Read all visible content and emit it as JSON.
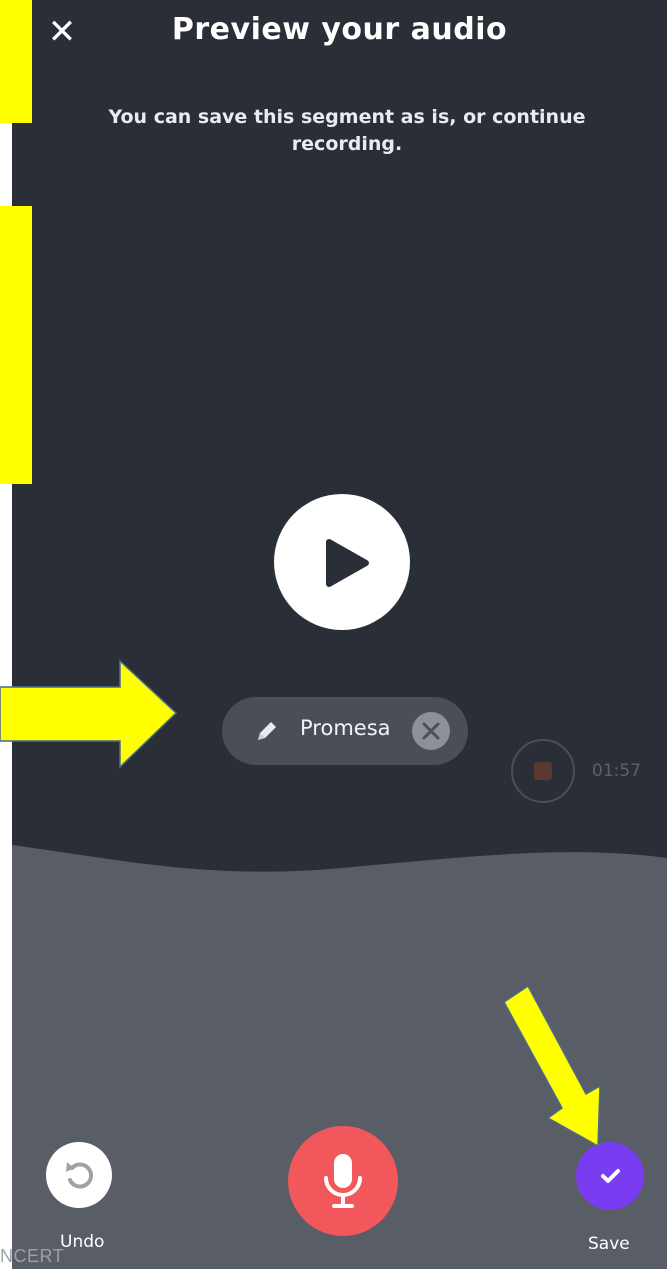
{
  "header": {
    "close_icon": "close-icon",
    "title": "Preview your audio",
    "subtitle": "You can save this segment as is, or continue recording."
  },
  "player": {
    "play_icon": "play-icon"
  },
  "segment_chip": {
    "edit_icon": "pencil-icon",
    "label": "Promesa",
    "clear_icon": "close-circle-icon"
  },
  "recorder": {
    "stop_icon": "stop-icon",
    "timer": "01:57"
  },
  "bottom_bar": {
    "undo_label": "Undo",
    "undo_icon": "undo-icon",
    "mic_icon": "microphone-icon",
    "save_label": "Save",
    "save_icon": "check-icon"
  },
  "watermark": "NCERT",
  "colors": {
    "background_top": "#2a2e36",
    "background_bottom": "#595d66",
    "accent_record": "#f2575b",
    "accent_save": "#7a3cf0",
    "annotation_highlight": "#ffff00"
  }
}
